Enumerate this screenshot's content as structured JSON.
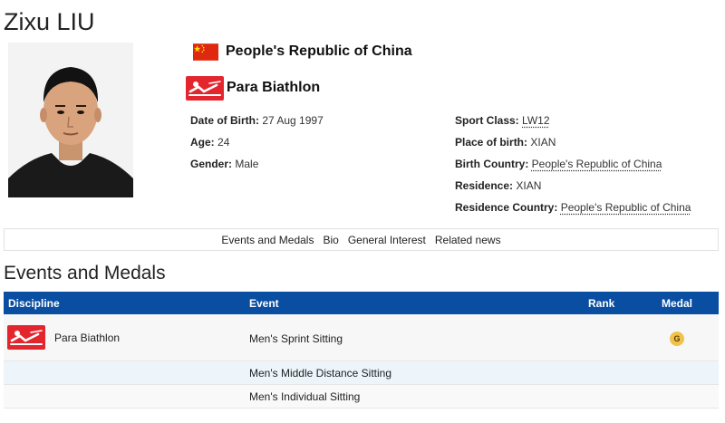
{
  "athlete": {
    "name": "Zixu LIU",
    "country": "People's Republic of China",
    "sport": "Para Biathlon"
  },
  "details": {
    "left": [
      {
        "label": "Date of Birth:",
        "value": "27 Aug 1997"
      },
      {
        "label": "Age:",
        "value": "24"
      },
      {
        "label": "Gender:",
        "value": "Male"
      }
    ],
    "right": [
      {
        "label": "Sport Class:",
        "value": "LW12"
      },
      {
        "label": "Place of birth:",
        "value": "XIAN"
      },
      {
        "label": "Birth Country:",
        "value": "People's Republic of China"
      },
      {
        "label": "Residence:",
        "value": "XIAN"
      },
      {
        "label": "Residence Country:",
        "value": "People's Republic of China"
      }
    ]
  },
  "subnav": [
    "Events and Medals",
    "Bio",
    "General Interest",
    "Related news"
  ],
  "events_section": {
    "title": "Events and Medals",
    "headers": {
      "discipline": "Discipline",
      "event": "Event",
      "rank": "Rank",
      "medal": "Medal"
    },
    "rows": [
      {
        "discipline": "Para Biathlon",
        "event": "Men's Sprint Sitting",
        "rank": "",
        "medal": "G"
      },
      {
        "discipline": "",
        "event": "Men's Middle Distance Sitting",
        "rank": "",
        "medal": ""
      },
      {
        "discipline": "",
        "event": "Men's Individual Sitting",
        "rank": "",
        "medal": ""
      }
    ]
  },
  "colors": {
    "header_bar": "#0a4ea1",
    "pictogram_red": "#e3262d",
    "flag_red": "#de2910",
    "flag_yellow": "#ffde00",
    "medal_gold": "#f0c24a"
  },
  "icons": {
    "flag": "china-flag-icon",
    "sport": "para-biathlon-pictogram-icon",
    "medal": "gold-medal-icon"
  }
}
